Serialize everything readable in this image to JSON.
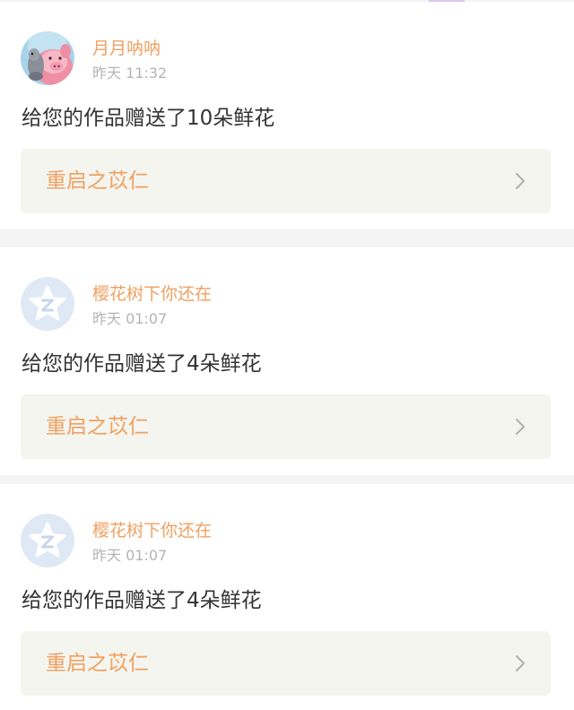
{
  "colors": {
    "background": "#f4f4f4",
    "card": "#ffffff",
    "username": "#f0a060",
    "timestamp": "#b4b4b4",
    "message": "#333333",
    "link_box": "#f5f5ef",
    "link_text": "#f0a060",
    "chevron": "#b0b0b0",
    "default_avatar": "#dfe8f5"
  },
  "notifications": [
    {
      "avatar_icon": "pig-cartoon-icon",
      "username": "月月呐呐",
      "time": "昨天 11:32",
      "message": "给您的作品赠送了10朵鲜花",
      "work_title": "重启之苡仁",
      "link_icon": "chevron-right-icon"
    },
    {
      "avatar_icon": "default-avatar-icon",
      "username": "樱花树下你还在",
      "time": "昨天 01:07",
      "message": "给您的作品赠送了4朵鲜花",
      "work_title": "重启之苡仁",
      "link_icon": "chevron-right-icon"
    },
    {
      "avatar_icon": "default-avatar-icon",
      "username": "樱花树下你还在",
      "time": "昨天 01:07",
      "message": "给您的作品赠送了4朵鲜花",
      "work_title": "重启之苡仁",
      "link_icon": "chevron-right-icon"
    }
  ]
}
